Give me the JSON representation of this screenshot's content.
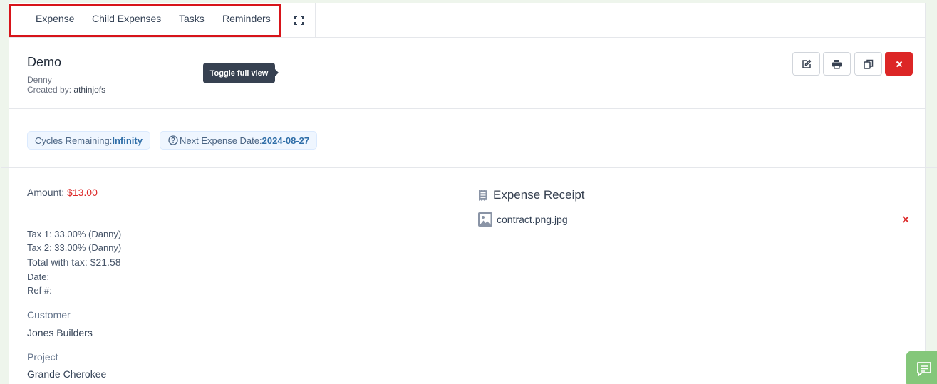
{
  "tabs": [
    {
      "label": "Expense"
    },
    {
      "label": "Child Expenses"
    },
    {
      "label": "Tasks"
    },
    {
      "label": "Reminders"
    }
  ],
  "header": {
    "title": "Demo",
    "subtitle_name": "Denny",
    "created_by_label": "Created by:",
    "created_by_value": "athinjofs",
    "tooltip": "Toggle full view"
  },
  "actions": [
    "edit-icon",
    "print-icon",
    "copy-icon",
    "delete-icon"
  ],
  "badges": {
    "cycles_label": "Cycles Remaining:",
    "cycles_value": "Infinity",
    "next_label": "Next Expense Date:",
    "next_value": "2024-08-27"
  },
  "details": {
    "amount_label": "Amount:",
    "amount_value": "$13.00",
    "tax1": "Tax 1: 33.00% (Danny)",
    "tax2": "Tax 2: 33.00% (Danny)",
    "total_with_tax": "Total with tax: $21.58",
    "date_label": "Date:",
    "ref_label": "Ref #:",
    "customer_label": "Customer",
    "customer_value": "Jones Builders",
    "project_label": "Project",
    "project_value": "Grande Cherokee"
  },
  "receipt": {
    "title": "Expense Receipt",
    "file_name": "contract.png.jpg"
  },
  "colors": {
    "danger": "#dc2626",
    "highlight_border": "#d7141a",
    "badge_bg": "#eff6ff",
    "badge_value": "#2f6ea8",
    "chat_button": "#84c77a"
  }
}
